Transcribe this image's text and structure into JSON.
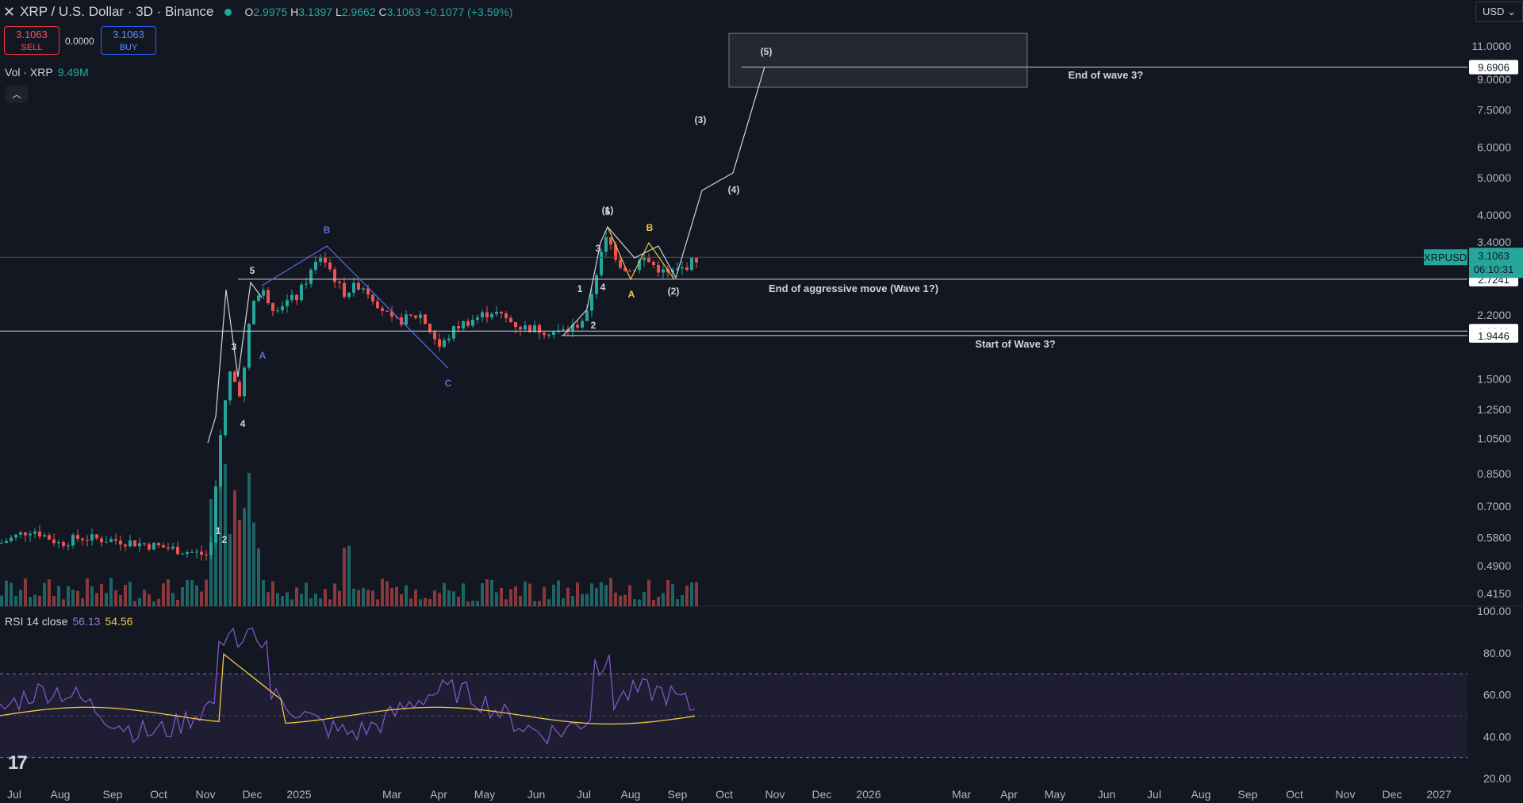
{
  "header": {
    "title": "XRP / U.S. Dollar · 3D · Binance",
    "open": "2.9975",
    "high": "3.1397",
    "low": "2.9662",
    "close": "3.1063",
    "change": "+0.1077 (+3.59%)"
  },
  "trade": {
    "sell_price": "3.1063",
    "sell_label": "SELL",
    "spread": "0.0000",
    "buy_price": "3.1063",
    "buy_label": "BUY"
  },
  "volume": {
    "label": "Vol · XRP",
    "value": "9.49M"
  },
  "rsi": {
    "label": "RSI 14 close",
    "value": "56.13",
    "ma": "54.56",
    "upper": 70,
    "lower": 30,
    "ticks": [
      "100.00",
      "80.00",
      "60.00",
      "40.00",
      "20.00"
    ]
  },
  "currency_select": "USD",
  "colors": {
    "up": "#26a69a",
    "down": "#ef5350",
    "rsi": "#7e57c2",
    "rsi_ma": "#f2c744",
    "wave_white": "#d1d4dc",
    "wave_blue": "#5b6cd6",
    "wave_yellow": "#f2c744"
  },
  "chart_data": {
    "type": "candlestick",
    "x_axis_labels": [
      "Jul",
      "Aug",
      "Sep",
      "Oct",
      "Nov",
      "Dec",
      "2025",
      "Mar",
      "Apr",
      "May",
      "Jun",
      "Jul",
      "Aug",
      "Sep",
      "Oct",
      "Nov",
      "Dec",
      "2026",
      "Mar",
      "Apr",
      "May",
      "Jun",
      "Jul",
      "Aug",
      "Sep",
      "Oct",
      "Nov",
      "Dec",
      "2027"
    ],
    "y_scale": "log",
    "y_ticks": [
      "11.0000",
      "9.0000",
      "7.5000",
      "6.0000",
      "5.0000",
      "4.0000",
      "3.4000",
      "2.2000",
      "1.5000",
      "1.2500",
      "1.0500",
      "0.8500",
      "0.7000",
      "0.5800",
      "0.4900",
      "0.4150"
    ],
    "last_price": 3.1063,
    "symbol_tag": "XRPUSD",
    "countdown": "06:10:31",
    "price_levels": [
      {
        "value": 9.6906,
        "label": "9.6906",
        "note": "End of wave 3?"
      },
      {
        "value": 2.7241,
        "label": "2.7241",
        "note": "End of aggressive move (Wave 1?)"
      },
      {
        "value": 1.9962,
        "label": "1.9962",
        "note": ""
      },
      {
        "value": 1.9446,
        "label": "1.9446",
        "note": "Start of Wave 3?"
      }
    ],
    "wave_labels": {
      "impulse_2024": [
        "1",
        "2",
        "3",
        "4",
        "5"
      ],
      "correction": [
        "A",
        "B",
        "C"
      ],
      "impulse_2025": [
        "1",
        "2",
        "3",
        "4",
        "5"
      ],
      "abc_2025": [
        "A",
        "B"
      ],
      "projection": [
        "(1)",
        "(2)",
        "(3)",
        "(4)",
        "(5)"
      ]
    }
  }
}
